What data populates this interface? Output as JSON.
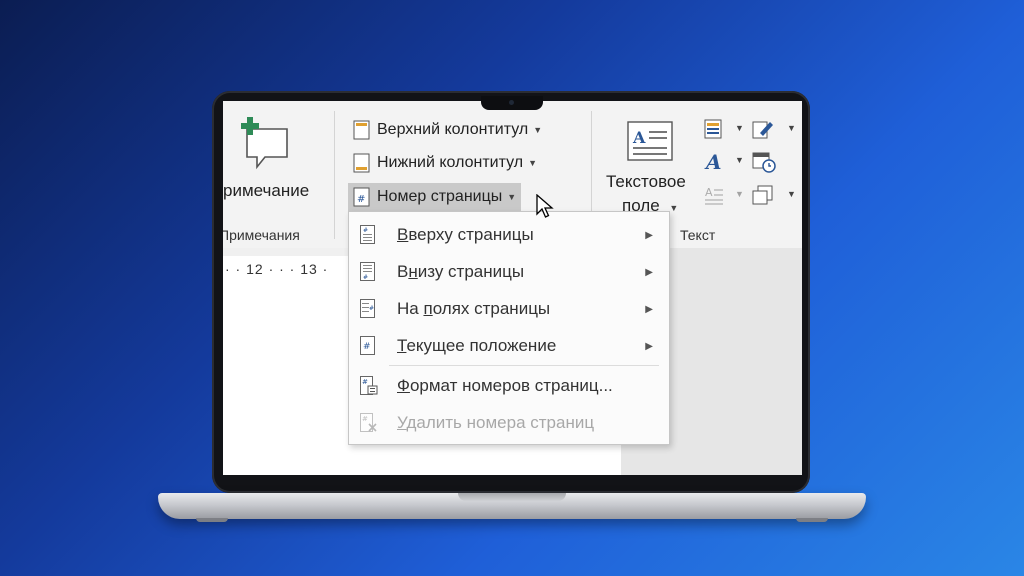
{
  "ribbon": {
    "comments_group": {
      "button_label": "римечание",
      "group_label": "Примечания"
    },
    "header_footer_group": {
      "header_label": "Верхний колонтитул",
      "footer_label": "Нижний колонтитул",
      "page_number_label": "Номер страницы"
    },
    "text_group": {
      "textbox_label_line1": "Текстовое",
      "textbox_label_line2": "поле",
      "group_label": "Текст"
    }
  },
  "ruler": {
    "ticks": "· · 12 · · · 13 ·"
  },
  "page_number_menu": {
    "items": [
      {
        "prefix": "",
        "u": "В",
        "rest": "верху страницы",
        "submenu": true,
        "enabled": true
      },
      {
        "prefix": "В",
        "u": "н",
        "rest": "изу страницы",
        "submenu": true,
        "enabled": true
      },
      {
        "prefix": "На ",
        "u": "п",
        "rest": "олях страницы",
        "submenu": true,
        "enabled": true
      },
      {
        "prefix": "",
        "u": "Т",
        "rest": "екущее положение",
        "submenu": true,
        "enabled": true
      },
      {
        "prefix": "",
        "u": "Ф",
        "rest": "ормат номеров страниц...",
        "submenu": false,
        "enabled": true
      },
      {
        "prefix": "",
        "u": "У",
        "rest": "далить номера страниц",
        "submenu": false,
        "enabled": false
      }
    ]
  },
  "colors": {
    "accent_green": "#2e8b57",
    "ribbon_bg": "#f3f3f3",
    "highlight": "#c9c9c9",
    "icon_blue": "#2b5797"
  }
}
